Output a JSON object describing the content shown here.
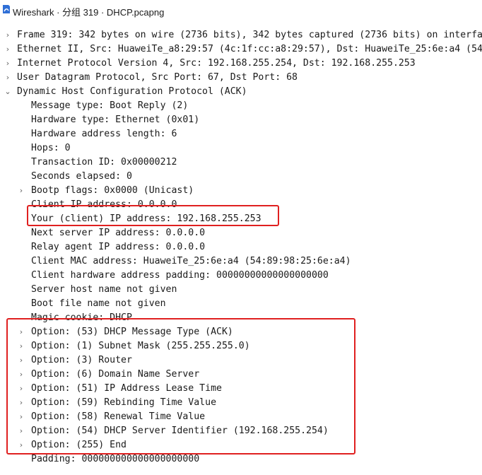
{
  "window": {
    "title": "Wireshark · 分组 319 · DHCP.pcapng"
  },
  "tree": {
    "top": [
      {
        "label": "Frame 319: 342 bytes on wire (2736 bits), 342 bytes captured (2736 bits) on interfa",
        "expanded": false
      },
      {
        "label": "Ethernet II, Src: HuaweiTe_a8:29:57 (4c:1f:cc:a8:29:57), Dst: HuaweiTe_25:6e:a4 (54",
        "expanded": false
      },
      {
        "label": "Internet Protocol Version 4, Src: 192.168.255.254, Dst: 192.168.255.253",
        "expanded": false
      },
      {
        "label": "User Datagram Protocol, Src Port: 67, Dst Port: 68",
        "expanded": false
      },
      {
        "label": "Dynamic Host Configuration Protocol (ACK)",
        "expanded": true
      }
    ],
    "dhcp": {
      "message_type": "Message type: Boot Reply (2)",
      "hardware_type": "Hardware type: Ethernet (0x01)",
      "hardware_address_length": "Hardware address length: 6",
      "hops": "Hops: 0",
      "transaction_id": "Transaction ID: 0x00000212",
      "seconds_elapsed": "Seconds elapsed: 0",
      "bootp_flags": "Bootp flags: 0x0000 (Unicast)",
      "client_ip": "Client IP address: 0.0.0.0",
      "your_ip": "Your (client) IP address: 192.168.255.253",
      "next_server_ip": "Next server IP address: 0.0.0.0",
      "relay_agent_ip": "Relay agent IP address: 0.0.0.0",
      "client_mac": "Client MAC address: HuaweiTe_25:6e:a4 (54:89:98:25:6e:a4)",
      "client_hw_padding": "Client hardware address padding: 00000000000000000000",
      "server_host_name": "Server host name not given",
      "boot_file_name": "Boot file name not given",
      "magic_cookie": "Magic cookie: DHCP",
      "options": [
        "Option: (53) DHCP Message Type (ACK)",
        "Option: (1) Subnet Mask (255.255.255.0)",
        "Option: (3) Router",
        "Option: (6) Domain Name Server",
        "Option: (51) IP Address Lease Time",
        "Option: (59) Rebinding Time Value",
        "Option: (58) Renewal Time Value",
        "Option: (54) DHCP Server Identifier (192.168.255.254)",
        "Option: (255) End"
      ],
      "padding": "Padding: 000000000000000000000"
    }
  },
  "icons": {
    "collapsed": "›",
    "expanded": "⌄",
    "app": "wireshark-fin-icon"
  },
  "colors": {
    "highlight_border": "#e02020",
    "selected_row": "#cde8ff",
    "app_icon": "#2f6fd6"
  }
}
